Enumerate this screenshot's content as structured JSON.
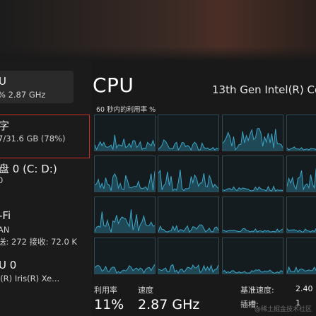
{
  "sidebar": {
    "items": [
      {
        "title": "U",
        "subtitle": "% 2.87 GHz"
      },
      {
        "title": "字",
        "subtitle": "7/31.6 GB (78%)"
      },
      {
        "title": "盘 0 (C: D:)",
        "subtitle": "0"
      },
      {
        "title": "-Fi",
        "subtitle": "AN",
        "subtitle2": "送: 272 接收: 72.0 K"
      },
      {
        "title": "U 0",
        "subtitle": "l(R) Iris(R) Xe..."
      }
    ]
  },
  "main": {
    "title": "CPU",
    "model": "13th Gen Intel(R) Co",
    "graph_caption": "60 秒内的利用率 %"
  },
  "stats": {
    "util_label": "利用率",
    "speed_label": "速度",
    "util_value": "11%",
    "speed_value": "2.87 GHz",
    "base_speed_label": "基准速度:",
    "base_speed_value": "2.40",
    "sockets_label": "插槽:",
    "sockets_value": "1"
  },
  "watermark": "@稀土掘金技术社区",
  "colors": {
    "accent_red": "#d02a22",
    "graph_line": "#3aa6c7",
    "graph_fill": "#2a6f86",
    "graph_border": "#2d4a55"
  }
}
